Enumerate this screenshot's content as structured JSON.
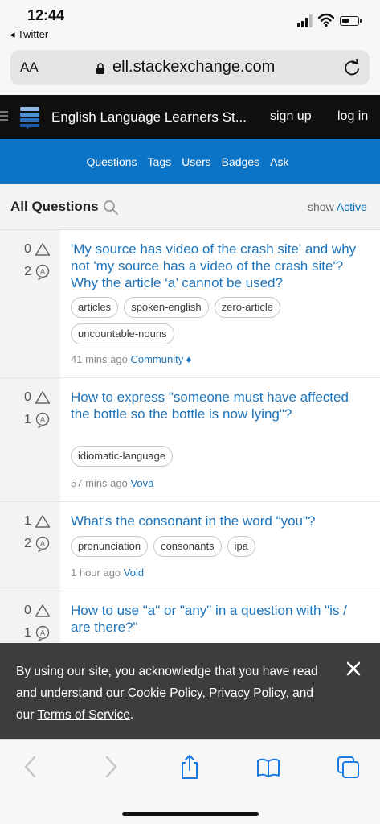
{
  "status_bar": {
    "time": "12:44",
    "back_app": "◂ Twitter"
  },
  "browser": {
    "aa_label": "AA",
    "url": "ell.stackexchange.com"
  },
  "site_header": {
    "title": "English Language Learners St...",
    "signup": "sign up",
    "login": "log in"
  },
  "nav": {
    "items": [
      "Questions",
      "Tags",
      "Users",
      "Badges",
      "Ask"
    ]
  },
  "list_header": {
    "title": "All Questions",
    "show_label": "show",
    "show_value": "Active"
  },
  "questions": [
    {
      "votes": "0",
      "answers": "2",
      "title": "'My source has video of the crash site' and why not 'my source has a video of the crash site'? Why the article ‘a’ cannot be used?",
      "tags": [
        "articles",
        "spoken-english",
        "zero-article",
        "uncountable-nouns"
      ],
      "time": "41 mins ago",
      "author": "Community ♦"
    },
    {
      "votes": "0",
      "answers": "1",
      "title": "How to express \"someone must have affected the bottle so the bottle is now lying\"?",
      "tags": [
        "idiomatic-language"
      ],
      "time": "57 mins ago",
      "author": "Vova"
    },
    {
      "votes": "1",
      "answers": "2",
      "title": "What's the consonant in the word \"you\"?",
      "tags": [
        "pronunciation",
        "consonants",
        "ipa"
      ],
      "time": "1 hour ago",
      "author": "Void"
    },
    {
      "votes": "0",
      "answers": "1",
      "title": "How to use \"a\" or \"any\" in a question with \"is / are there?\"",
      "tags": [],
      "time": "",
      "author": ""
    }
  ],
  "cookie_banner": {
    "text_1": "By using our site, you acknowledge that you have read and understand our ",
    "link_cookie": "Cookie Policy",
    "sep_1": ", ",
    "link_privacy": "Privacy Policy",
    "sep_2": ", and our ",
    "link_terms": "Terms of Service",
    "end": "."
  },
  "colors": {
    "nav_blue": "#0c74c6",
    "header_black": "#101010",
    "link_blue": "#1e73b8",
    "banner_gray": "#3b3d3f"
  },
  "icons": [
    "signal-icon",
    "wifi-icon",
    "battery-icon",
    "lock-icon",
    "reload-icon",
    "hamburger-icon",
    "stack-logo-icon",
    "search-icon",
    "vote-triangle-icon",
    "answer-bubble-icon",
    "close-icon",
    "back-icon",
    "forward-icon",
    "share-icon",
    "bookmarks-icon",
    "tabs-icon"
  ]
}
